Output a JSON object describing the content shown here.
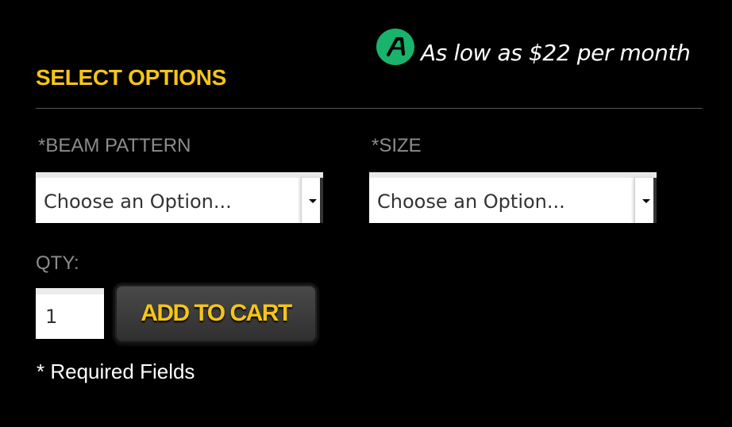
{
  "financing": {
    "logo_icon": "affirm-logo-icon",
    "text": "As low as $22 per month",
    "logo_color": "#19b36b"
  },
  "options": {
    "title": "SELECT OPTIONS",
    "beam_pattern": {
      "label": "*BEAM PATTERN",
      "value": "Choose an Option..."
    },
    "size": {
      "label": "*SIZE",
      "value": "Choose an Option..."
    }
  },
  "quantity": {
    "label": "QTY:",
    "value": "1"
  },
  "add_to_cart": {
    "label": "ADD TO CART"
  },
  "required_note": "* Required Fields",
  "colors": {
    "accent": "#f5c518",
    "background": "#000000",
    "label": "#8c8c8c"
  }
}
